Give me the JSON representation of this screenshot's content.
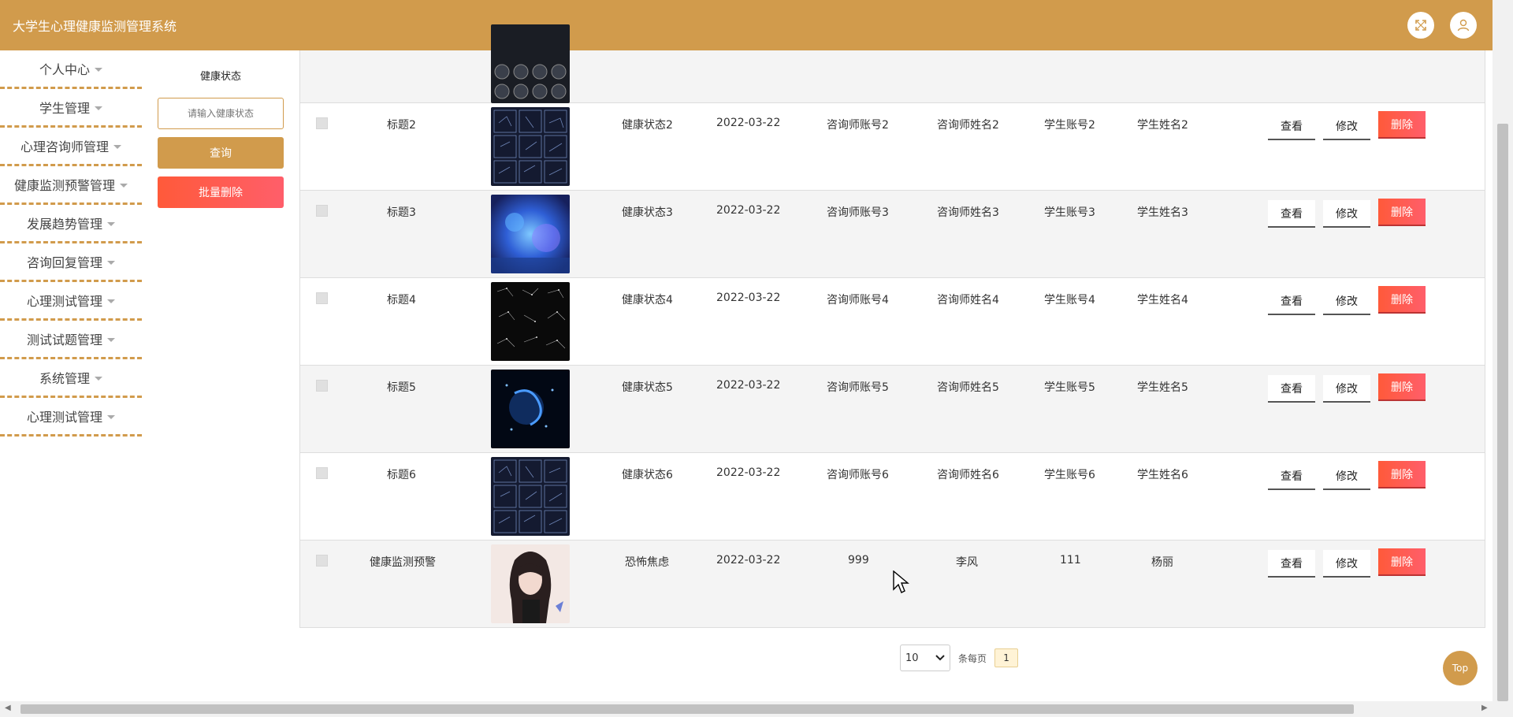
{
  "header": {
    "title": "大学生心理健康监测管理系统"
  },
  "sidebar": {
    "items": [
      {
        "label": "个人中心"
      },
      {
        "label": "学生管理"
      },
      {
        "label": "心理咨询师管理"
      },
      {
        "label": "健康监测预警管理"
      },
      {
        "label": "发展趋势管理"
      },
      {
        "label": "咨询回复管理"
      },
      {
        "label": "心理测试管理"
      },
      {
        "label": "测试试题管理"
      },
      {
        "label": "系统管理"
      },
      {
        "label": "心理测试管理"
      }
    ]
  },
  "search": {
    "label": "健康状态",
    "placeholder": "请输入健康状态",
    "query_label": "查询",
    "batch_delete_label": "批量删除"
  },
  "actions": {
    "view": "查看",
    "edit": "修改",
    "delete": "删除"
  },
  "rows": [
    {
      "title": "标题2",
      "status": "健康状态2",
      "date": "2022-03-22",
      "counselor_account": "咨询师账号2",
      "counselor_name": "咨询师姓名2",
      "student_account": "学生账号2",
      "student_name": "学生姓名2"
    },
    {
      "title": "标题3",
      "status": "健康状态3",
      "date": "2022-03-22",
      "counselor_account": "咨询师账号3",
      "counselor_name": "咨询师姓名3",
      "student_account": "学生账号3",
      "student_name": "学生姓名3"
    },
    {
      "title": "标题4",
      "status": "健康状态4",
      "date": "2022-03-22",
      "counselor_account": "咨询师账号4",
      "counselor_name": "咨询师姓名4",
      "student_account": "学生账号4",
      "student_name": "学生姓名4"
    },
    {
      "title": "标题5",
      "status": "健康状态5",
      "date": "2022-03-22",
      "counselor_account": "咨询师账号5",
      "counselor_name": "咨询师姓名5",
      "student_account": "学生账号5",
      "student_name": "学生姓名5"
    },
    {
      "title": "标题6",
      "status": "健康状态6",
      "date": "2022-03-22",
      "counselor_account": "咨询师账号6",
      "counselor_name": "咨询师姓名6",
      "student_account": "学生账号6",
      "student_name": "学生姓名6"
    },
    {
      "title": "健康监测预警",
      "status": "恐怖焦虑",
      "date": "2022-03-22",
      "counselor_account": "999",
      "counselor_name": "李风",
      "student_account": "111",
      "student_name": "杨丽"
    }
  ],
  "pagination": {
    "page_size": "10",
    "per_page_label": "条每页",
    "current_page": "1"
  },
  "top_button": {
    "label": "Top"
  }
}
